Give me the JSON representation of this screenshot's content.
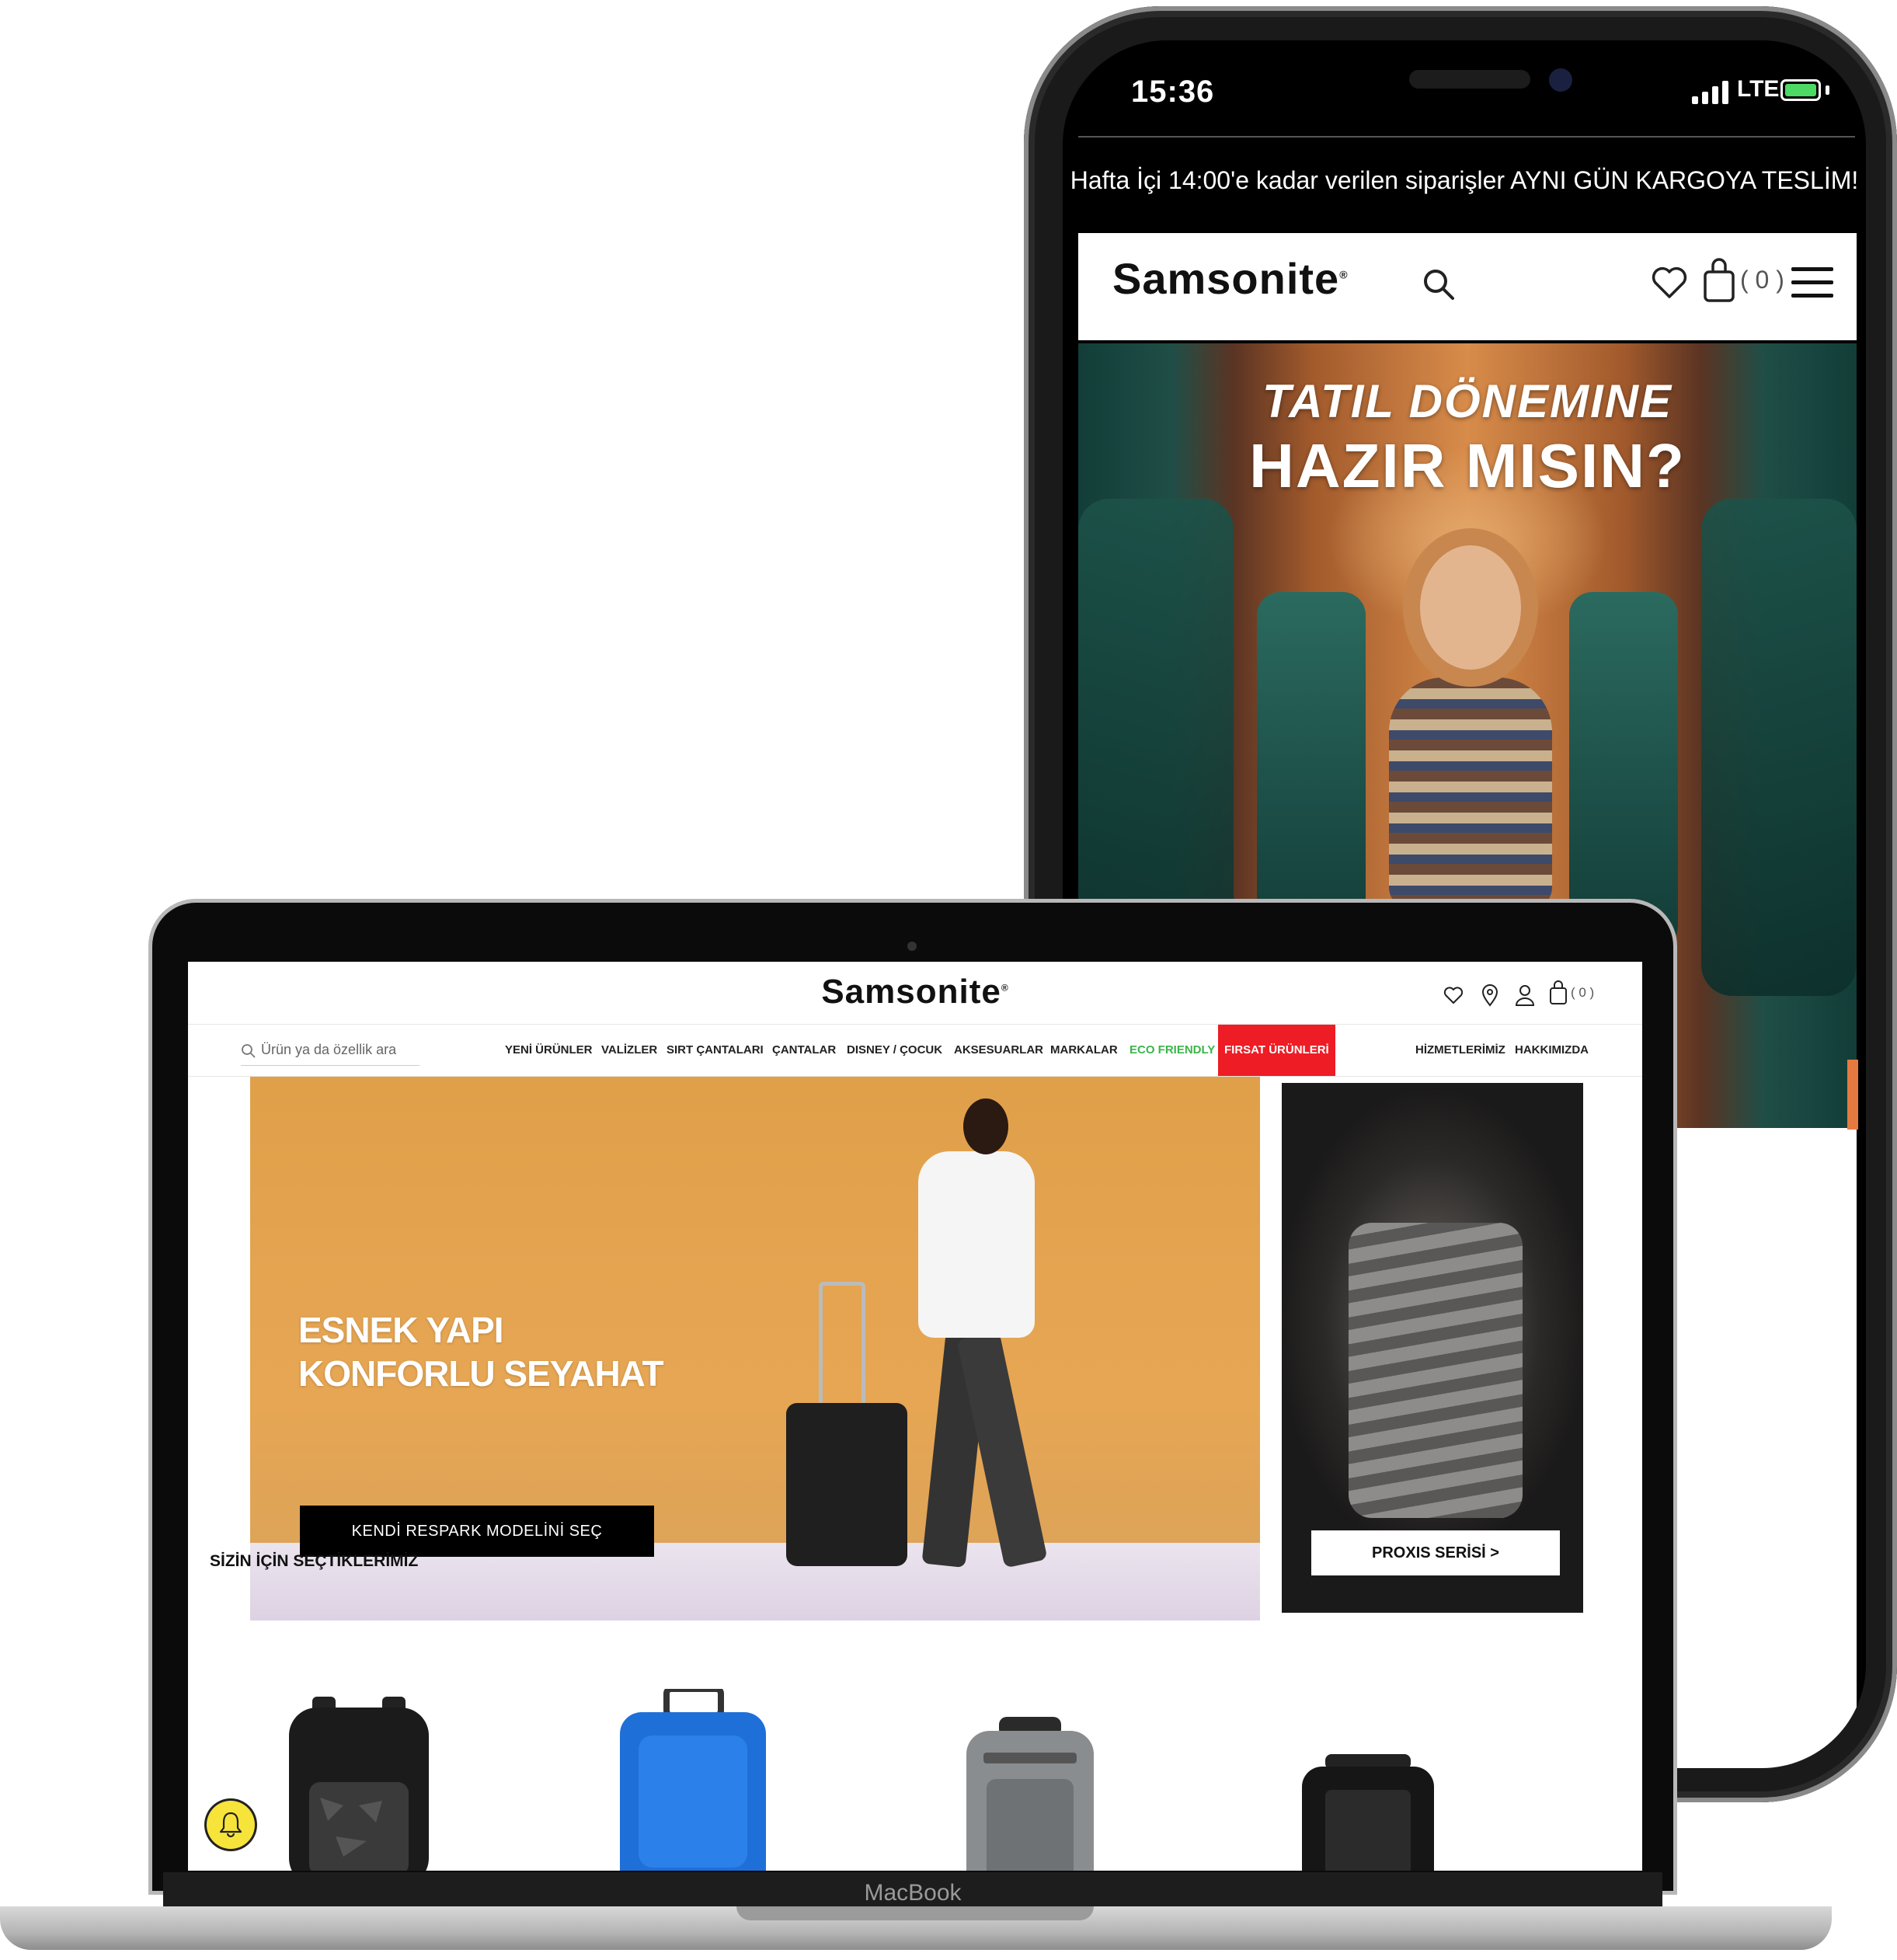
{
  "phone": {
    "status_time": "15:36",
    "network": "LTE",
    "announcement": "Hafta İçi 14:00'e kadar verilen siparişler AYNI GÜN KARGOYA TESLİM!",
    "logo": "Samsonite",
    "cart_count": "( 0 )",
    "hero_line1": "TATIL DÖNEMINE",
    "hero_line2": "HAZIR MISIN?",
    "colors": {
      "battery": "#4cd964",
      "accent": "#e47a3f"
    }
  },
  "laptop": {
    "logo": "Samsonite",
    "cart_count": "( 0 )",
    "search_placeholder": "Ürün ya da özellik ara",
    "nav": [
      {
        "label": "YENİ ÜRÜNLER"
      },
      {
        "label": "VALİZLER"
      },
      {
        "label": "SIRT ÇANTALARI"
      },
      {
        "label": "ÇANTALAR"
      },
      {
        "label": "DISNEY / ÇOCUK"
      },
      {
        "label": "AKSESUARLAR"
      },
      {
        "label": "MARKALAR"
      },
      {
        "label": "ECO FRIENDLY"
      },
      {
        "label": "FIRSAT ÜRÜNLERİ"
      }
    ],
    "nav_right": [
      {
        "label": "HİZMETLERİMİZ"
      },
      {
        "label": "HAKKIMIZDA"
      }
    ],
    "hero_line1": "ESNEK YAPI",
    "hero_line2": "KONFORLU SEYAHAT",
    "hero_button": "KENDİ RESPARK MODELİNİ SEÇ",
    "side_button": "PROXIS SERİSİ >",
    "section_title": "SİZİN İÇİN SEÇTİKLERİMİZ",
    "device_label": "MacBook",
    "colors": {
      "eco": "#3bb54a",
      "sale": "#ee1c25",
      "bell": "#f7e43a",
      "hero": "#e0a04a"
    }
  }
}
